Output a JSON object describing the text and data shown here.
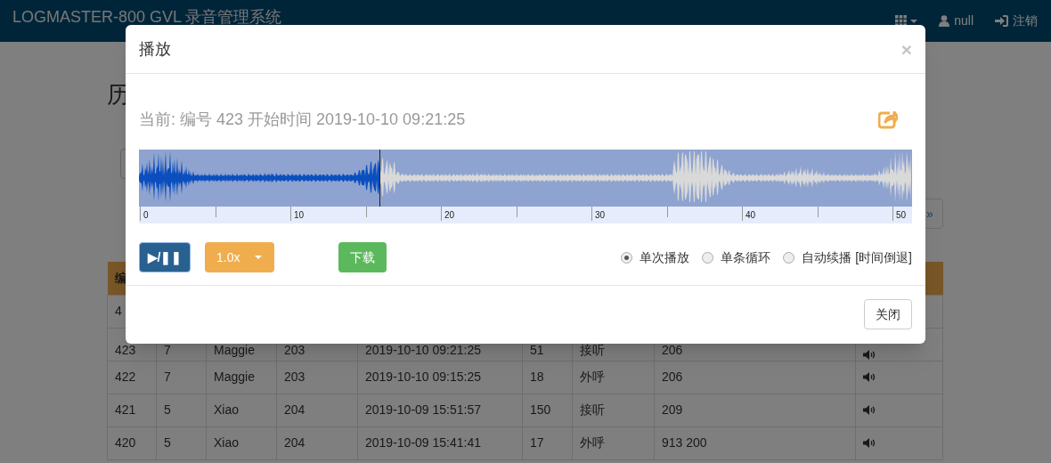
{
  "navbar": {
    "title": "LOGMASTER-800 GVL 录音管理系统",
    "user": "null",
    "logout": "注销"
  },
  "page": {
    "heading": "历",
    "pager_next": "»",
    "table": {
      "columns": [
        "编"
      ],
      "rows": [
        {
          "cells": [
            "4"
          ]
        },
        {
          "cells": [
            "423",
            "7",
            "Maggie",
            "203",
            "2019-10-10 09:21:25",
            "51",
            "接听",
            "206"
          ]
        },
        {
          "cells": [
            "422",
            "7",
            "Maggie",
            "203",
            "2019-10-10 09:15:25",
            "18",
            "外呼",
            "206"
          ]
        },
        {
          "cells": [
            "421",
            "5",
            "Xiao",
            "204",
            "2019-10-09 15:51:57",
            "150",
            "接听",
            "209"
          ]
        },
        {
          "cells": [
            "420",
            "5",
            "Xiao",
            "204",
            "2019-10-09 15:41:41",
            "17",
            "外呼",
            "913 200"
          ]
        }
      ]
    }
  },
  "modal": {
    "title": "播放",
    "close": "×",
    "current": "当前: 编号 423 开始时间 2019-10-10 09:21:25",
    "waveform": {
      "level": 0.311,
      "ticks": [
        "0",
        "10",
        "20",
        "30",
        "40",
        "50"
      ]
    },
    "play_pause": "▶/❚❚",
    "speed": "1.0x",
    "download": "下载",
    "modes": [
      {
        "label": "单次播放",
        "selected": true
      },
      {
        "label": "单条循环",
        "selected": false
      },
      {
        "label": "自动续播 [时间倒退]",
        "selected": false
      }
    ],
    "close_button": "关闭"
  }
}
